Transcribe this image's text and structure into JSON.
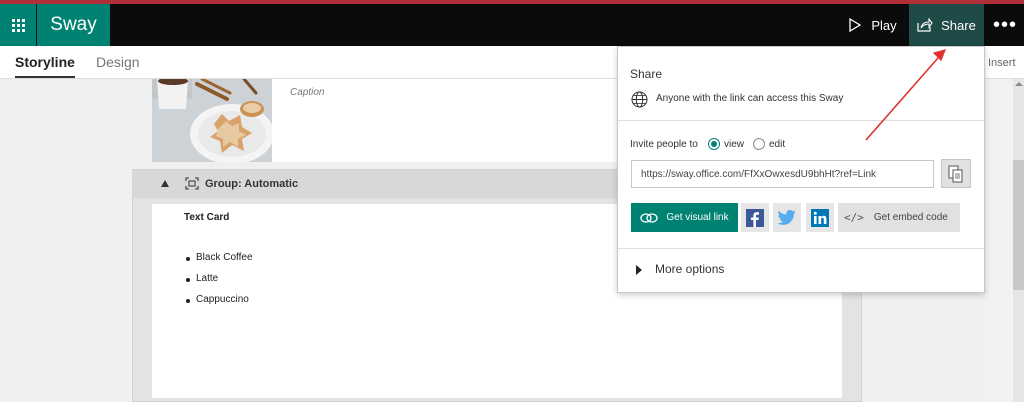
{
  "app": {
    "name": "Sway"
  },
  "topbar": {
    "play_label": "Play",
    "share_label": "Share",
    "more_label": "•••"
  },
  "tabs": [
    {
      "label": "Storyline",
      "active": true
    },
    {
      "label": "Design",
      "active": false
    }
  ],
  "insert_label": "Insert",
  "image_card": {
    "caption_placeholder": "Caption"
  },
  "group": {
    "label": "Group: Automatic"
  },
  "text_card": {
    "title": "Text Card",
    "items": [
      "Black Coffee",
      "Latte",
      "Cappuccino"
    ]
  },
  "share_panel": {
    "title": "Share",
    "access_text": "Anyone with the link can access this Sway",
    "invite_label": "Invite people to",
    "options": [
      "view",
      "edit"
    ],
    "selected_option": "view",
    "link_url": "https://sway.office.com/FfXxOwxesdU9bhHt?ref=Link",
    "visual_link_label": "Get visual link",
    "embed_label": "Get embed code",
    "more_options_label": "More options",
    "social": [
      "facebook-icon",
      "twitter-icon",
      "linkedin-icon"
    ]
  },
  "colors": {
    "accent": "#008272",
    "topbar": "#0b0b0b",
    "share_button_bg": "#1e4a47",
    "annotation_arrow": "#e03030",
    "facebook": "#3b5998",
    "twitter": "#55acee",
    "linkedin": "#0077b5"
  }
}
